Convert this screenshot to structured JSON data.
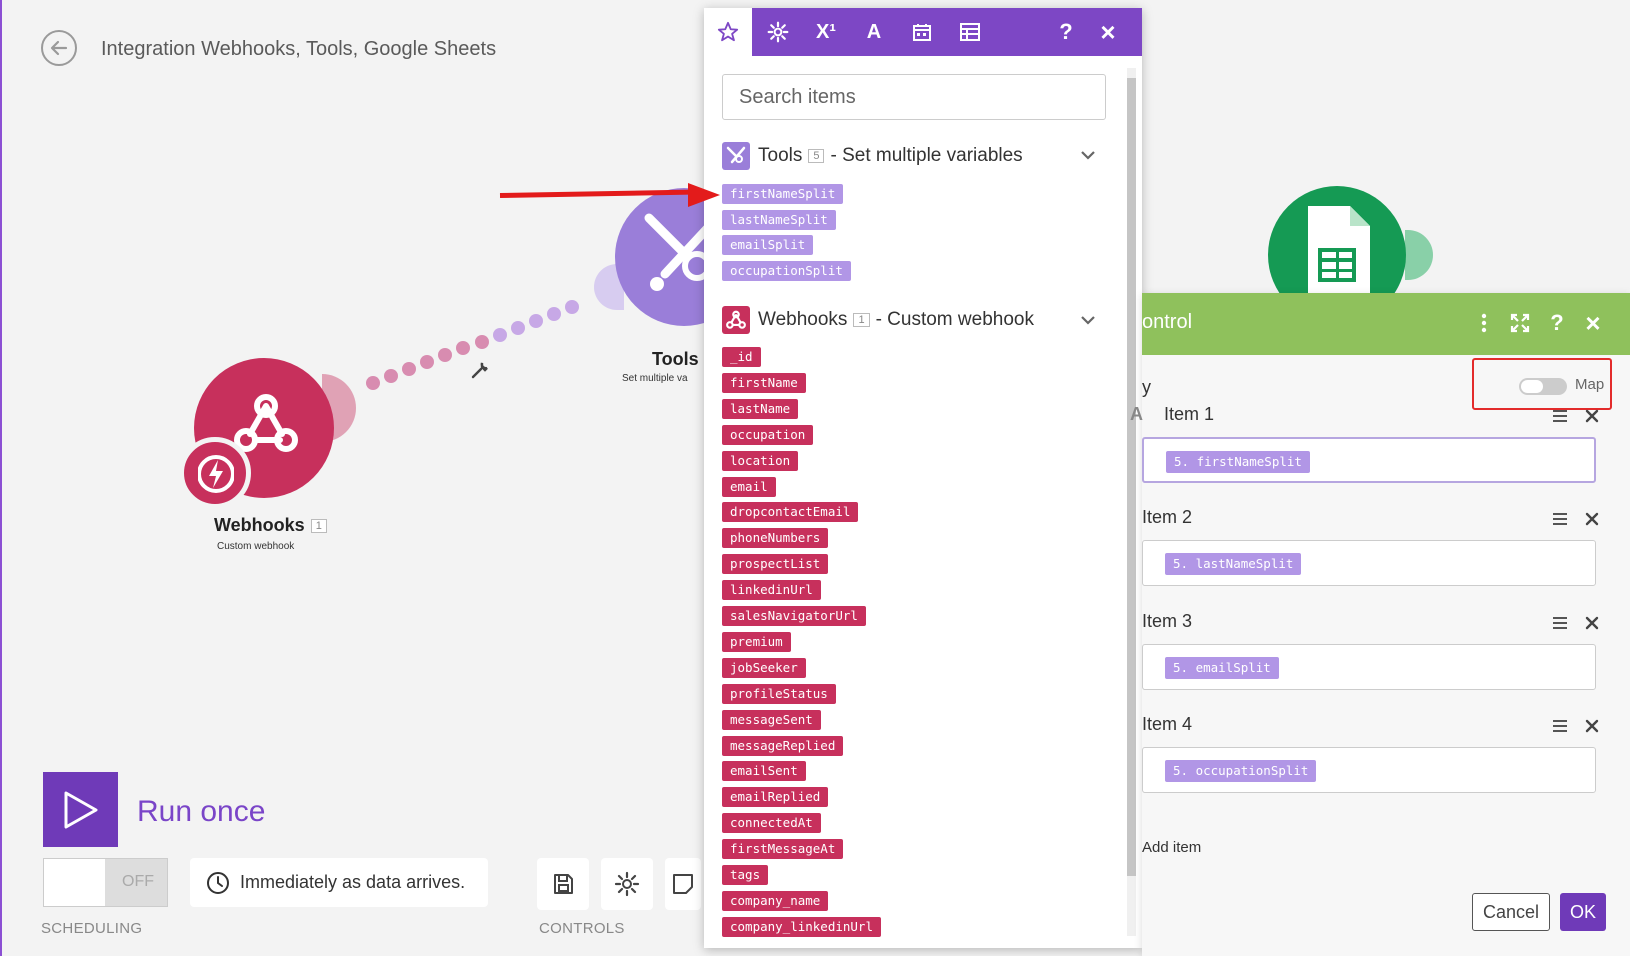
{
  "header": {
    "title": "Integration Webhooks, Tools, Google Sheets"
  },
  "modules": {
    "webhooks": {
      "name": "Webhooks",
      "count": "1",
      "subtitle": "Custom webhook",
      "color": "#c7305c"
    },
    "tools": {
      "name": "Tools",
      "subtitle": "Set multiple va",
      "color": "#9a7ed9"
    },
    "sheets": {
      "color": "#159a54"
    }
  },
  "footer": {
    "run_label": "Run once",
    "toggle_label": "OFF",
    "schedule_text": "Immediately as data arrives.",
    "scheduling_caption": "SCHEDULING",
    "controls_caption": "CONTROLS"
  },
  "mapping_panel": {
    "tabs": [
      {
        "name": "star",
        "label": "☆"
      },
      {
        "name": "gear",
        "label": "⚙"
      },
      {
        "name": "math",
        "label": "X¹"
      },
      {
        "name": "text",
        "label": "A"
      },
      {
        "name": "calendar",
        "label": ""
      },
      {
        "name": "table",
        "label": ""
      }
    ],
    "help": "?",
    "close": "×",
    "search_placeholder": "Search items",
    "tools_group": {
      "name": "Tools",
      "count": "5",
      "description": "- Set multiple variables",
      "items": [
        "firstNameSplit",
        "lastNameSplit",
        "emailSplit",
        "occupationSplit"
      ]
    },
    "webhooks_group": {
      "name": "Webhooks",
      "count": "1",
      "description": "- Custom webhook",
      "items": [
        "_id",
        "firstName",
        "lastName",
        "occupation",
        "location",
        "email",
        "dropcontactEmail",
        "phoneNumbers",
        "prospectList",
        "linkedinUrl",
        "salesNavigatorUrl",
        "premium",
        "jobSeeker",
        "profileStatus",
        "messageSent",
        "messageReplied",
        "emailSent",
        "emailReplied",
        "connectedAt",
        "firstMessageAt",
        "tags",
        "company_name",
        "company_linkedinUrl"
      ]
    }
  },
  "control_panel": {
    "title_fragment": "ontrol",
    "array_label_fragment": "y",
    "map_label": "Map",
    "text_type_glyph": "A",
    "items": [
      {
        "label": "Item 1",
        "value": "5. firstNameSplit"
      },
      {
        "label": "Item 2",
        "value": "5. lastNameSplit"
      },
      {
        "label": "Item 3",
        "value": "5. emailSplit"
      },
      {
        "label": "Item 4",
        "value": "5. occupationSplit"
      }
    ],
    "add_item": "Add item",
    "cancel": "Cancel",
    "ok": "OK"
  }
}
